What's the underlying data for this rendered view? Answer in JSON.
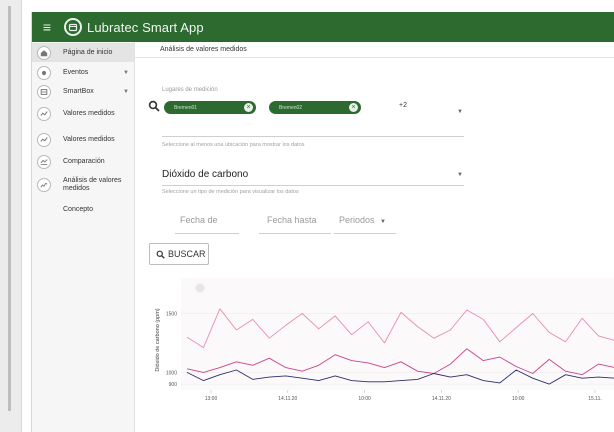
{
  "app": {
    "title": "Lubratec Smart App"
  },
  "sidebar": {
    "items": [
      {
        "label": "Página de inicio",
        "icon": "home-icon",
        "caret": false,
        "active": true
      },
      {
        "label": "Eventos",
        "icon": "events-icon",
        "caret": true,
        "active": false
      },
      {
        "label": "SmartBox",
        "icon": "smartbox-icon",
        "caret": true,
        "active": false
      },
      {
        "label": "Valores medidos",
        "icon": "chart-icon",
        "caret": false,
        "active": false
      },
      {
        "label": "Valores medidos",
        "icon": "chart-icon",
        "caret": false,
        "active": false
      },
      {
        "label": "Comparación",
        "icon": "compare-icon",
        "caret": false,
        "active": false
      },
      {
        "label": "Análisis de valores medidos",
        "icon": "analysis-icon",
        "caret": false,
        "active": false
      },
      {
        "label": "Concepto",
        "icon": "",
        "caret": false,
        "active": false
      }
    ]
  },
  "breadcrumb": "Análisis de valores medidos",
  "filters": {
    "locations_label": "Lugares de medición",
    "chips": [
      "Bremen01",
      "Bremen02"
    ],
    "more_count": "+2",
    "locations_hint": "Seleccione al menos una ubicación para mostrar los datos",
    "measurement_value": "Dióxido de carbono",
    "measurement_hint": "Seleccione un tipo de medición para visualizar los datos",
    "date_from": "Fecha de",
    "date_to": "Fecha hasta",
    "periods": "Periodos",
    "search_button": "BUSCAR"
  },
  "colors": {
    "brand": "#2d6a30",
    "series_pink": "#e98bb8",
    "series_magenta": "#c9438a",
    "series_navy": "#2c2f6b"
  },
  "chart_data": {
    "type": "line",
    "ylabel": "Dióxido de carbono (ppm)",
    "yticks": [
      900,
      1000,
      1500
    ],
    "ylim": [
      850,
      1700
    ],
    "xticks": [
      "13:00",
      "14.11.20",
      "10:00",
      "14.11.20",
      "10:00",
      "15.11."
    ],
    "grid": true,
    "series": [
      {
        "color": "#e98bb8",
        "values": [
          1300,
          1210,
          1540,
          1360,
          1450,
          1290,
          1400,
          1500,
          1370,
          1480,
          1320,
          1430,
          1250,
          1510,
          1390,
          1290,
          1360,
          1530,
          1450,
          1260,
          1380,
          1500,
          1340,
          1260,
          1460,
          1310,
          1270
        ]
      },
      {
        "color": "#c9438a",
        "values": [
          1030,
          1000,
          1040,
          1090,
          1060,
          1120,
          1040,
          1010,
          1060,
          1150,
          1100,
          1080,
          1040,
          1090,
          1010,
          990,
          1070,
          1200,
          1100,
          1130,
          1050,
          990,
          1110,
          1010,
          980,
          1070,
          1040
        ]
      },
      {
        "color": "#2c2f6b",
        "values": [
          1000,
          930,
          980,
          1020,
          940,
          960,
          970,
          950,
          930,
          970,
          930,
          920,
          920,
          930,
          940,
          990,
          960,
          980,
          930,
          910,
          1020,
          950,
          900,
          980,
          950,
          960,
          950
        ]
      }
    ]
  }
}
